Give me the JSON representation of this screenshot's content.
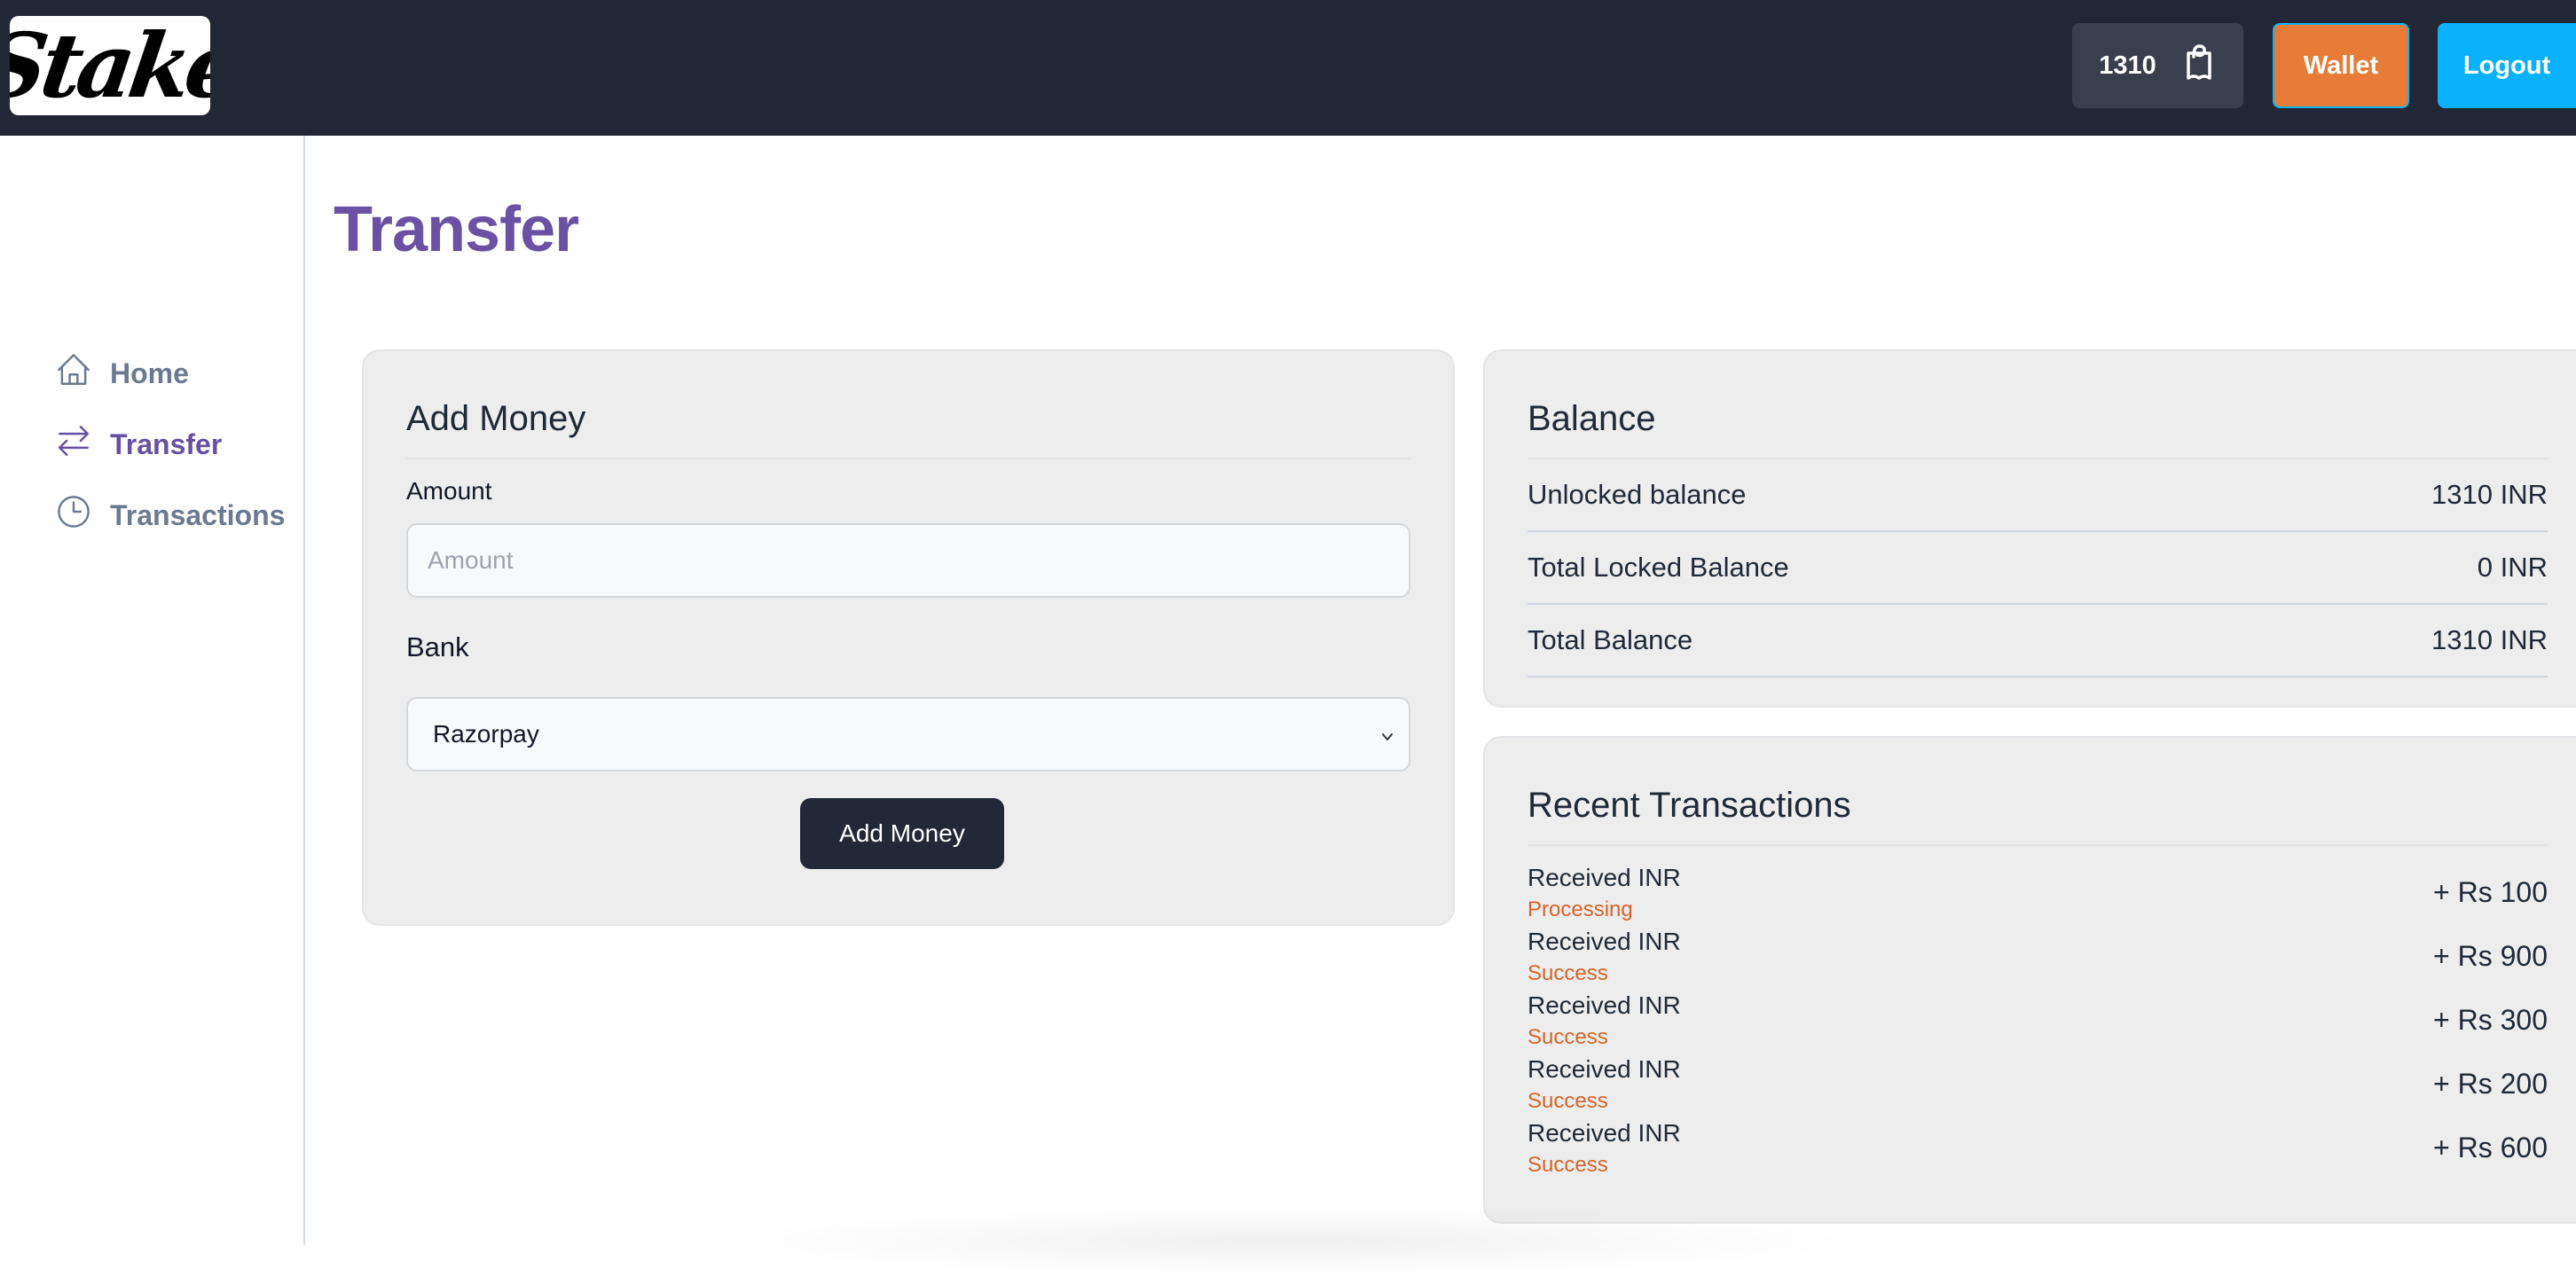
{
  "header": {
    "logo_text": "Stake",
    "balance": "1310",
    "wallet_label": "Wallet",
    "logout_label": "Logout",
    "balance_icon": "shopping-bag-icon"
  },
  "sidebar": {
    "items": [
      {
        "label": "Home",
        "icon": "home-icon",
        "active": false
      },
      {
        "label": "Transfer",
        "icon": "arrows-right-left-icon",
        "active": true
      },
      {
        "label": "Transactions",
        "icon": "clock-icon",
        "active": false
      }
    ]
  },
  "page": {
    "title": "Transfer"
  },
  "add_money": {
    "title": "Add Money",
    "amount_label": "Amount",
    "amount_value": "",
    "amount_placeholder": "Amount",
    "bank_label": "Bank",
    "bank_selected": "Razorpay",
    "submit_label": "Add Money"
  },
  "balance": {
    "title": "Balance",
    "rows": [
      {
        "label": "Unlocked balance",
        "value": "1310 INR"
      },
      {
        "label": "Total Locked Balance",
        "value": "0 INR"
      },
      {
        "label": "Total Balance",
        "value": "1310 INR"
      }
    ]
  },
  "recent_transactions": {
    "title": "Recent Transactions",
    "items": [
      {
        "title": "Received INR",
        "status": "Processing",
        "amount": "+ Rs 100"
      },
      {
        "title": "Received INR",
        "status": "Success",
        "amount": "+ Rs 900"
      },
      {
        "title": "Received INR",
        "status": "Success",
        "amount": "+ Rs 300"
      },
      {
        "title": "Received INR",
        "status": "Success",
        "amount": "+ Rs 200"
      },
      {
        "title": "Received INR",
        "status": "Success",
        "amount": "+ Rs 600"
      }
    ]
  },
  "colors": {
    "header_bg": "#222735",
    "accent_purple": "#6a51a3",
    "wallet_orange": "#e67c37",
    "logout_blue": "#0cb1fb",
    "status_orange": "#d96328"
  }
}
